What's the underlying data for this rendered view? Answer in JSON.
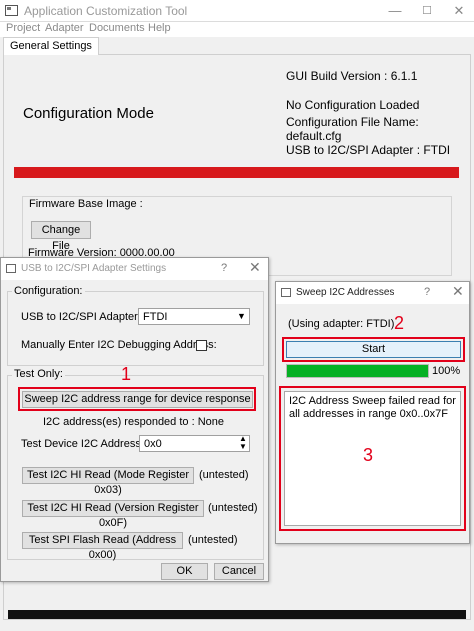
{
  "window": {
    "title": "Application Customization Tool",
    "minimize": "—",
    "maximize": "☐",
    "close": "✕"
  },
  "menu": [
    "Project",
    "Adapter",
    "Documents",
    "Help"
  ],
  "tabs": [
    "General Settings"
  ],
  "main": {
    "mode_label": "Configuration Mode",
    "gui_build": "GUI Build Version : 6.1.1",
    "config_status": "No Configuration Loaded",
    "config_file": "Configuration File Name: default.cfg",
    "adapter": "USB to I2C/SPI Adapter : FTDI",
    "firmware_group_title": "Firmware Base Image :",
    "change_file": "Change File",
    "firmware_version": "Firmware Version:  0000.00.00",
    "status_bar_color": "#d7191c"
  },
  "dialog1": {
    "title": "USB to I2C/SPI Adapter Settings",
    "help": "?",
    "close": "✕",
    "config_group": "Configuration:",
    "adapter_label": "USB to I2C/SPI Adapter:",
    "adapter_value": "FTDI",
    "manual_label": "Manually Enter I2C Debugging Address:",
    "manual_checked": false,
    "test_group": "Test Only:",
    "sweep_button": "Sweep I2C address range for device response",
    "responded": "I2C address(es) responded to : None",
    "test_addr_label": "Test Device I2C Address:",
    "test_addr_value": "0x0",
    "read_mode_button": "Test I2C HI Read (Mode Register 0x03)",
    "read_mode_status": "(untested)",
    "read_version_button": "Test I2C HI Read (Version Register 0x0F)",
    "read_version_status": "(untested)",
    "spi_button": "Test SPI Flash Read (Address 0x00)",
    "spi_status": "(untested)",
    "ok": "OK",
    "cancel": "Cancel"
  },
  "dialog2": {
    "title": "Sweep I2C Addresses",
    "help": "?",
    "close": "✕",
    "using_adapter": "(Using adapter: FTDI)",
    "start_button": "Start",
    "progress": 1.0,
    "progress_text": "100%",
    "progress_color": "#06b025",
    "result": "I2C Address Sweep failed read for all addresses in range 0x0..0x7F"
  },
  "callouts": [
    "1",
    "2",
    "3"
  ],
  "accent_color": "#e2001a"
}
